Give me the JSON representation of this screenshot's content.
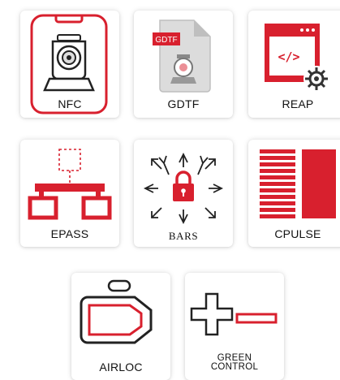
{
  "tiles": [
    {
      "id": "nfc",
      "label": "NFC",
      "icon": "phone-moving-head-icon"
    },
    {
      "id": "gdtf",
      "label": "GDTF",
      "icon": "gdtf-file-icon",
      "badge": "GDTF"
    },
    {
      "id": "reap",
      "label": "REAP",
      "icon": "code-window-gear-icon",
      "code_glyph": "</>"
    },
    {
      "id": "epass",
      "label": "EPASS",
      "icon": "network-tree-icon"
    },
    {
      "id": "bars",
      "label": "BARS",
      "icon": "lock-arrows-icon"
    },
    {
      "id": "cpulse",
      "label": "CPULSE",
      "icon": "striped-bars-icon"
    },
    {
      "id": "airloc",
      "label": "AIRLOC",
      "icon": "fixture-topview-icon"
    },
    {
      "id": "green-control",
      "label": "GREEN\nCONTROL",
      "icon": "plus-minus-icon"
    }
  ],
  "colors": {
    "accent": "#d8202e",
    "dark": "#1a1a1a",
    "shadow": "#d0d0d0"
  }
}
